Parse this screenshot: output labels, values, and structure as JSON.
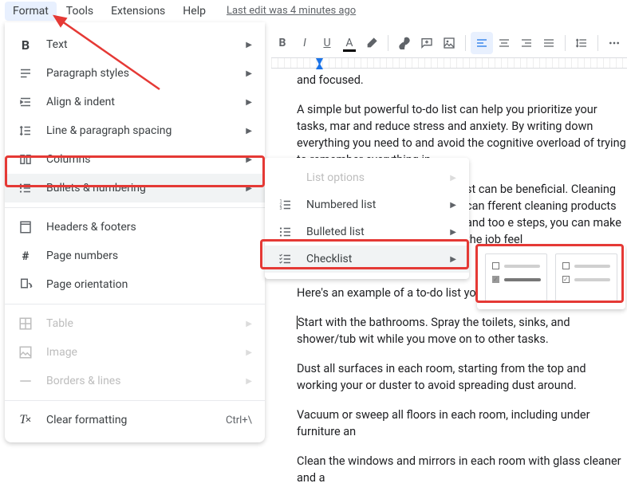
{
  "menubar": {
    "items": [
      "Format",
      "Tools",
      "Extensions",
      "Help"
    ],
    "last_edit": "Last edit was 4 minutes ago"
  },
  "format_menu": {
    "items": [
      {
        "icon": "bold-icon",
        "label": "Text",
        "submenu": true
      },
      {
        "icon": "paragraph-styles-icon",
        "label": "Paragraph styles",
        "submenu": true
      },
      {
        "icon": "align-indent-icon",
        "label": "Align & indent",
        "submenu": true
      },
      {
        "icon": "line-spacing-icon",
        "label": "Line & paragraph spacing",
        "submenu": true
      },
      {
        "icon": "columns-icon",
        "label": "Columns",
        "submenu": true
      },
      {
        "icon": "bullets-numbering-icon",
        "label": "Bullets & numbering",
        "submenu": true,
        "highlighted": true
      },
      {
        "sep": true
      },
      {
        "icon": "headers-footers-icon",
        "label": "Headers & footers"
      },
      {
        "icon": "page-numbers-icon",
        "label": "Page numbers"
      },
      {
        "icon": "page-orientation-icon",
        "label": "Page orientation"
      },
      {
        "sep": true
      },
      {
        "icon": "table-icon",
        "label": "Table",
        "submenu": true,
        "disabled": true
      },
      {
        "icon": "image-icon",
        "label": "Image",
        "submenu": true,
        "disabled": true
      },
      {
        "icon": "borders-lines-icon",
        "label": "Borders & lines",
        "submenu": true,
        "disabled": true
      },
      {
        "sep": true
      },
      {
        "icon": "clear-formatting-icon",
        "label": "Clear formatting",
        "shortcut": "Ctrl+\\"
      }
    ]
  },
  "bullets_submenu": {
    "items": [
      {
        "icon": "list-options-icon",
        "label": "List options",
        "submenu": true,
        "disabled": true
      },
      {
        "icon": "numbered-list-icon",
        "label": "Numbered list",
        "submenu": true
      },
      {
        "icon": "bulleted-list-icon",
        "label": "Bulleted list",
        "submenu": true
      },
      {
        "icon": "checklist-icon",
        "label": "Checklist",
        "submenu": true,
        "highlighted": true
      }
    ]
  },
  "checklist_styles": {
    "options": [
      "checkbox-plain",
      "checkbox-strikethrough"
    ]
  },
  "document": {
    "paragraphs": [
      "and focused.",
      "A simple but powerful to-do list can help you prioritize your tasks, mar and reduce stress and anxiety. By writing down everything you need to and avoid the cognitive overload of trying to remember everything in",
      "st can be beneficial. Cleaning can fferent cleaning products and too e steps, you can make the job feel",
      "Here's an example of a to-do list you",
      "Start with the bathrooms. Spray the toilets, sinks, and shower/tub wit while you move on to other tasks.",
      "Dust all surfaces in each room, starting from the top and working your or duster to avoid spreading dust around.",
      "Vacuum or sweep all floors in each room, including under furniture an",
      "Clean the windows and mirrors in each room with glass cleaner and a"
    ]
  },
  "toolbar": {
    "buttons": [
      "bold",
      "italic",
      "underline",
      "text-color",
      "highlight",
      "link",
      "comment",
      "image",
      "align-left",
      "align-center",
      "align-right",
      "align-justify",
      "line-spacing",
      "more"
    ]
  }
}
